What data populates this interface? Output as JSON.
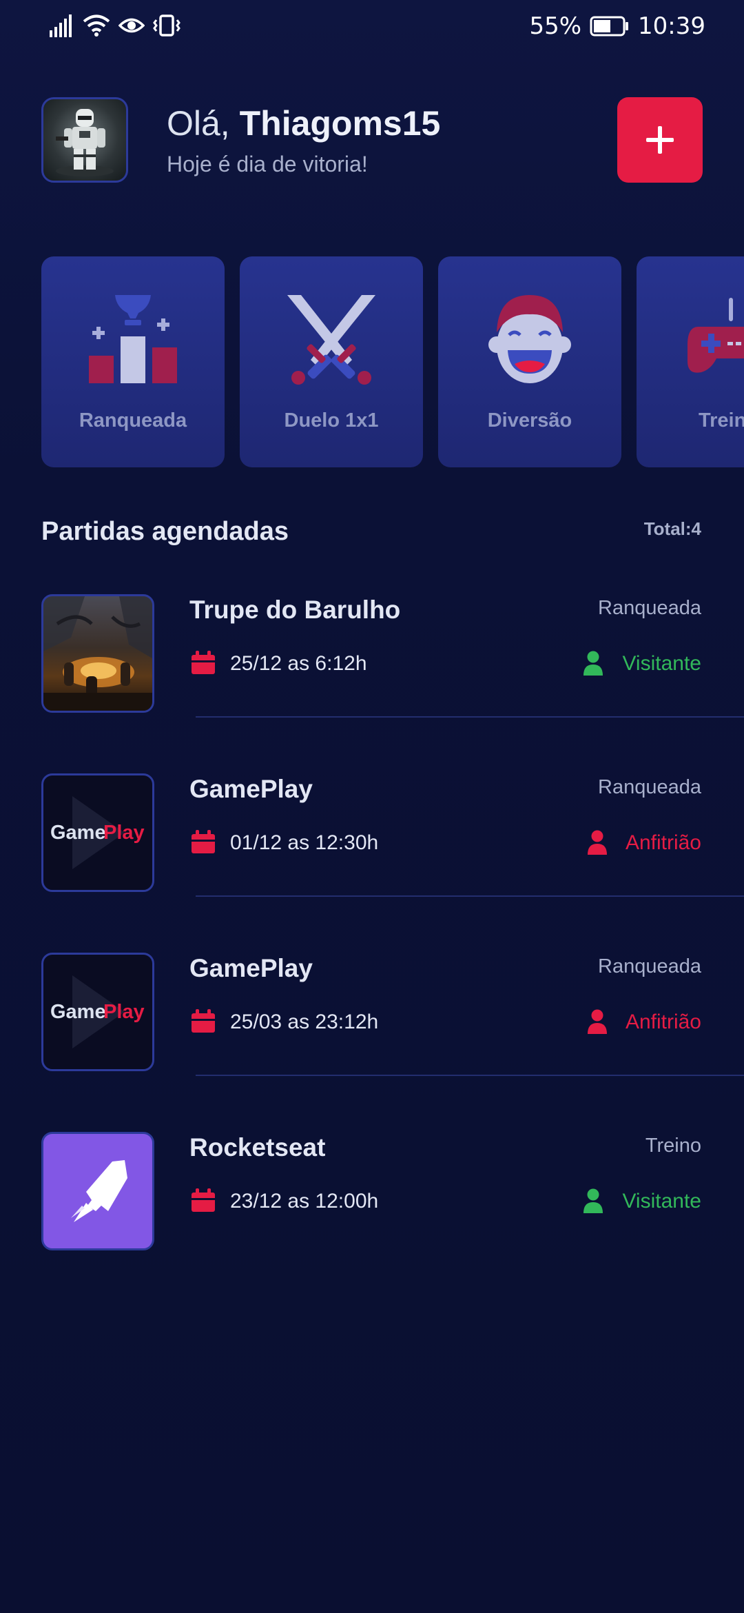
{
  "status": {
    "battery": "55%",
    "time": "10:39"
  },
  "header": {
    "greeting": "Olá,",
    "username": "Thiagoms15",
    "subtitle": "Hoje é dia de vitoria!",
    "add_label": "+"
  },
  "categories": [
    {
      "label": "Ranqueada",
      "icon": "ranked-podium-icon"
    },
    {
      "label": "Duelo 1x1",
      "icon": "crossed-swords-icon"
    },
    {
      "label": "Diversão",
      "icon": "laughing-face-icon"
    },
    {
      "label": "Treino",
      "icon": "gamepad-icon"
    }
  ],
  "matches_section": {
    "title": "Partidas agendadas",
    "total": "Total:4"
  },
  "matches": [
    {
      "name": "Trupe do Barulho",
      "category": "Ranqueada",
      "date": "25/12 as 6:12h",
      "role": "Visitante",
      "thumbnail": "trupe"
    },
    {
      "name": "GamePlay",
      "category": "Ranqueada",
      "date": "01/12 as 12:30h",
      "role": "Anfitrião",
      "thumbnail": "gameplay",
      "thumb_text_a": "Game",
      "thumb_text_b": "Play"
    },
    {
      "name": "GamePlay",
      "category": "Ranqueada",
      "date": "25/03 as 23:12h",
      "role": "Anfitrião",
      "thumbnail": "gameplay",
      "thumb_text_a": "Game",
      "thumb_text_b": "Play"
    },
    {
      "name": "Rocketseat",
      "category": "Treino",
      "date": "23/12 as 12:00h",
      "role": "Visitante",
      "thumbnail": "rocketseat"
    }
  ],
  "colors": {
    "background": "#0b1033",
    "accent": "#e51c44",
    "card": "#27338f",
    "visitor": "#32b85a",
    "host": "#e51c44"
  }
}
